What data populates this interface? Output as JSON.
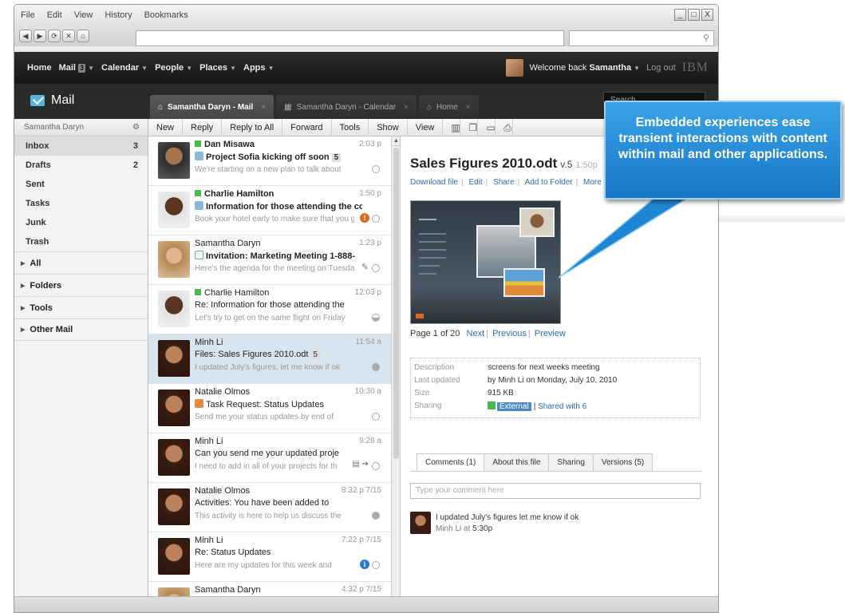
{
  "browser": {
    "menu": [
      "File",
      "Edit",
      "View",
      "History",
      "Bookmarks"
    ],
    "window_buttons": [
      "_",
      "□",
      "X"
    ],
    "nav_buttons": [
      "◀",
      "▶",
      "⟳",
      "✕",
      "⌂"
    ],
    "address_value": "",
    "search_value": ""
  },
  "topnav": {
    "items": [
      {
        "label": "Home"
      },
      {
        "label": "Mail",
        "badge": "3"
      },
      {
        "label": "Calendar"
      },
      {
        "label": "People"
      },
      {
        "label": "Places"
      },
      {
        "label": "Apps"
      }
    ],
    "welcome_prefix": "Welcome back",
    "user": "Samantha",
    "logout": "Log out",
    "logo": "IBM"
  },
  "mailbar": {
    "title": "Mail",
    "tabs": [
      {
        "label": "Samantha Daryn - Mail"
      },
      {
        "label": "Samantha Daryn - Calendar"
      },
      {
        "label": "Home"
      }
    ],
    "search_placeholder": "Search"
  },
  "leftnav": {
    "account": "Samantha Daryn",
    "folders": [
      {
        "label": "Inbox",
        "count": "3"
      },
      {
        "label": "Drafts",
        "count": "2"
      },
      {
        "label": "Sent",
        "count": ""
      },
      {
        "label": "Tasks",
        "count": ""
      },
      {
        "label": "Junk",
        "count": ""
      },
      {
        "label": "Trash",
        "count": ""
      }
    ],
    "sections": [
      "All",
      "Folders",
      "Tools",
      "Other Mail"
    ]
  },
  "toolbar": {
    "buttons": [
      "New",
      "Reply",
      "Reply to All",
      "Forward",
      "Tools",
      "Show",
      "View"
    ]
  },
  "messages": [
    {
      "from": "Dan Misawa",
      "subject": "Project Sofia kicking off soon",
      "thread": "5",
      "snippet": "We're starting on a new plan to talk about",
      "time": "2:03 p"
    },
    {
      "from": "Charlie Hamilton",
      "subject": "Information for those attending the con",
      "snippet": "Book your hotel early to make sure that you g",
      "time": "1:50 p"
    },
    {
      "from": "Samantha Daryn",
      "subject": "Invitation: Marketing Meeting 1-888-",
      "snippet": "Here's the agenda for the meeting on Tuesday",
      "time": "1:23 p"
    },
    {
      "from": "Charlie Hamilton",
      "subject": "Re: Information for those attending the",
      "snippet": "Let's try to get on the same flight on Friday",
      "time": "12:03 p"
    },
    {
      "from": "Minh Li",
      "subject": "Files: Sales Figures 2010.odt",
      "thread": "5",
      "snippet": "I updated July's figures, let me know if ok",
      "time": "11:54 a"
    },
    {
      "from": "Natalie Olmos",
      "subject": "Task Request: Status Updates",
      "snippet": "Send me your status updates by end of",
      "time": "10:30 a"
    },
    {
      "from": "Minh Li",
      "subject": "Can you send me your updated proje",
      "snippet": "I need to add in all of your projects for th",
      "time": "9:28 a"
    },
    {
      "from": "Natalie Olmos",
      "subject": "Activities: You have been added to",
      "snippet": "This activity is here to help us discuss the",
      "time": "8:32 p  7/15"
    },
    {
      "from": "Minh Li",
      "subject": "Re: Status Updates",
      "snippet": "Here are my updates for this week and",
      "time": "7:22 p  7/15"
    },
    {
      "from": "Samantha Daryn",
      "subject": "",
      "snippet": "",
      "time": "4:32 p  7/15"
    }
  ],
  "preview": {
    "title": "Sales Figures 2010.odt",
    "version": "v.5",
    "time": "1:50p",
    "links": [
      "Download file",
      "Edit",
      "Share",
      "Add to Folder",
      "More ▾"
    ],
    "page_label": "Page",
    "page_current": "1",
    "page_of": "of 20",
    "pager_links": [
      "Next",
      "Previous",
      "Preview"
    ],
    "meta": [
      {
        "key": "Description",
        "value": "screens for next weeks meeting"
      },
      {
        "key": "Last updated",
        "value": "by Minh Li on Monday, July 10, 2010"
      },
      {
        "key": "Size",
        "value": "915 KB"
      },
      {
        "key": "Sharing",
        "external": "External",
        "value": "Shared with 6"
      }
    ],
    "tabs": [
      "Comments (1)",
      "About this file",
      "Sharing",
      "Versions (5)"
    ],
    "comment_placeholder": "Type your comment here",
    "comment": {
      "text": "I updated July's figures let me know if ok",
      "author": "Minh Li at",
      "time": "5:30p"
    }
  },
  "callout": {
    "text": "Embedded experiences ease transient interactions with content within mail and other applications.",
    "color": "#1f86d4"
  }
}
